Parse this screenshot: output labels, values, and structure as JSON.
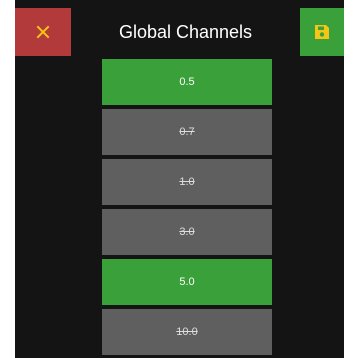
{
  "header": {
    "title": "Global Channels",
    "close_icon": "close-icon",
    "save_icon": "save-icon"
  },
  "colors": {
    "background": "#141414",
    "close_bg": "#b33a3a",
    "save_bg": "#3aa03a",
    "active_item": "#3aa03a",
    "inactive_item": "#5f5f5f",
    "close_icon_color": "#f5c518",
    "save_icon_color": "#f5c518"
  },
  "channels": [
    {
      "label": "0.5",
      "state": "on"
    },
    {
      "label": "0.7",
      "state": "off"
    },
    {
      "label": "1.0",
      "state": "off"
    },
    {
      "label": "3.0",
      "state": "off"
    },
    {
      "label": "5.0",
      "state": "on"
    },
    {
      "label": "10.0",
      "state": "off"
    }
  ]
}
